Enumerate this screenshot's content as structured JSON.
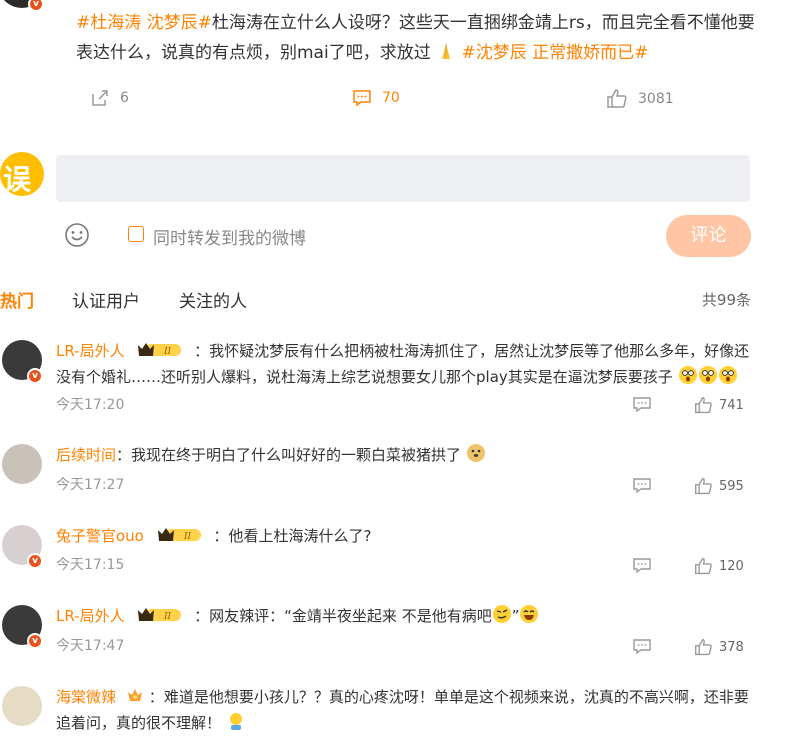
{
  "post": {
    "tag1": "#杜海涛 沈梦辰#",
    "text": "杜海涛在立什么人设呀？这些天一直捆绑金靖上rs，而且完全看不懂他要表达什么，说真的有点烦，别mai了吧，求放过",
    "tag2": "#沈梦辰 正常撒娇而已#",
    "repost_count": "6",
    "comment_count": "70",
    "like_count": "3081"
  },
  "composer": {
    "placeholder": "",
    "forward_label": "同时转发到我的微博",
    "submit_label": "评论"
  },
  "filters": {
    "hot": "热门",
    "verified": "认证用户",
    "following": "关注的人",
    "total": "共99条"
  },
  "comments": [
    {
      "user": "LR-局外人",
      "text": "我怀疑沈梦辰有什么把柄被杜海涛抓住了，居然让沈梦辰等了他那么多年，好像还没有个婚礼……还听别人爆料，说杜海涛上综艺说想要女儿那个play其实是在逼沈梦辰要孩子",
      "time": "今天17:20",
      "likes": "741"
    },
    {
      "user": "后续时间",
      "text": "我现在终于明白了什么叫好好的一颗白菜被猪拱了",
      "time": "今天17:27",
      "likes": "595"
    },
    {
      "user": "兔子警官ouo",
      "text": "他看上杜海涛什么了?",
      "time": "今天17:15",
      "likes": "120"
    },
    {
      "user": "LR-局外人",
      "text": "网友辣评：“金靖半夜坐起来 不是他有病吧",
      "text_end": "”",
      "time": "今天17:47",
      "likes": "378"
    },
    {
      "user": "海棠微辣",
      "text": "难道是他想要小孩儿？？真的心疼沈呀！单单是这个视频来说，沈真的不高兴啊，还非要追着问，真的很不理解！",
      "time": "",
      "likes": ""
    }
  ],
  "colors": {
    "accent": "#ff8200",
    "badge": "#e8521a",
    "submit_bg": "#ffc6a6",
    "input_bg": "#eff0f4"
  },
  "icons": [
    "repost-icon",
    "comment-icon",
    "like-icon",
    "smile-icon",
    "reply-icon",
    "level-badge-icon",
    "verified-badge-icon"
  ]
}
